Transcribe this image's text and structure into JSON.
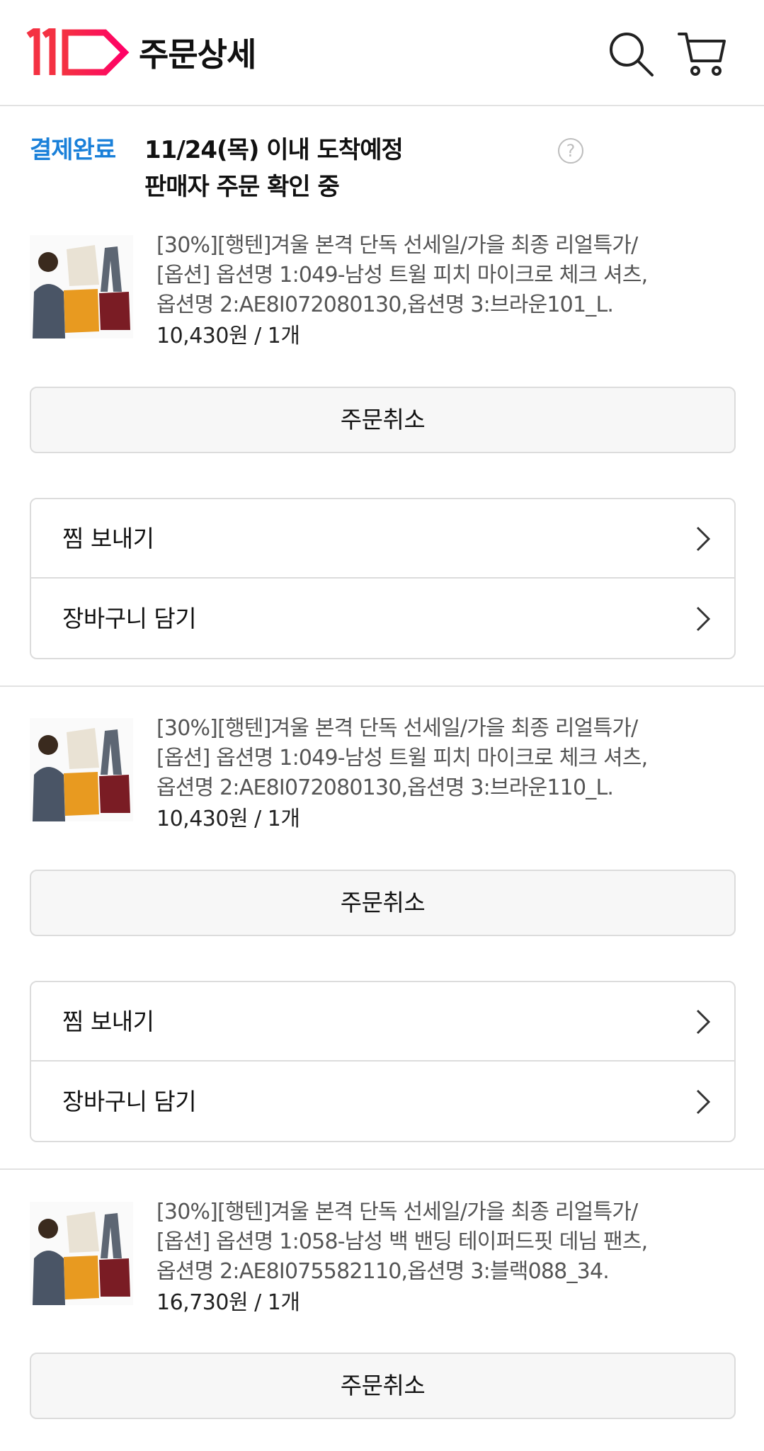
{
  "header": {
    "title": "주문상세",
    "logo_icon": "11st-logo",
    "search_icon": "search-icon",
    "cart_icon": "cart-icon"
  },
  "status": {
    "label": "결제완료",
    "line1": "11/24(목) 이내 도착예정",
    "line2": "판매자 주문 확인 중",
    "help": "?"
  },
  "orders": [
    {
      "name_lines": [
        "[30%][행텐]겨울 본격 단독 선세일/가을 최종 리얼특가/",
        "[옵션] 옵션명 1:049-남성 트윌 피치 마이크로 체크 셔츠,",
        "옵션명 2:AE8I072080130,옵션명 3:브라운101_L."
      ],
      "price": "10,430원 / 1개",
      "cancel_label": "주문취소",
      "actions": [
        "찜 보내기",
        "장바구니 담기"
      ]
    },
    {
      "name_lines": [
        "[30%][행텐]겨울 본격 단독 선세일/가을 최종 리얼특가/",
        "[옵션] 옵션명 1:049-남성 트윌 피치 마이크로 체크 셔츠,",
        "옵션명 2:AE8I072080130,옵션명 3:브라운110_L."
      ],
      "price": "10,430원 / 1개",
      "cancel_label": "주문취소",
      "actions": [
        "찜 보내기",
        "장바구니 담기"
      ]
    },
    {
      "name_lines": [
        "[30%][행텐]겨울 본격 단독 선세일/가을 최종 리얼특가/",
        "[옵션] 옵션명 1:058-남성 백 밴딩 테이퍼드핏 데님 팬츠,",
        "옵션명 2:AE8I075582110,옵션명 3:블랙088_34."
      ],
      "price": "16,730원 / 1개",
      "cancel_label": "주문취소"
    }
  ],
  "colors": {
    "status_blue": "#1a80d9",
    "logo_red": "#f43142",
    "logo_pink": "#ff0066"
  }
}
